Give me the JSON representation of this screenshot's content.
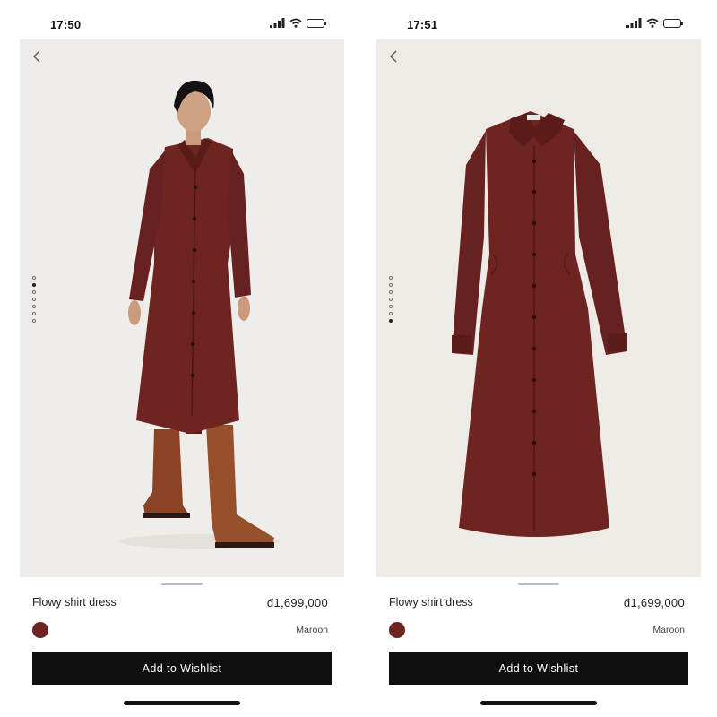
{
  "colors": {
    "dress": "#6e2420",
    "button_bg": "#0f0f0f",
    "photo_bg": "#efedea"
  },
  "screens": [
    {
      "status_time": "17:50",
      "image_type": "model-wearing-dress",
      "image_count": 7,
      "active_image": 1,
      "product_name": "Flowy shirt dress",
      "price": "đ1,699,000",
      "color_name": "Maroon",
      "button_label": "Add to Wishlist"
    },
    {
      "status_time": "17:51",
      "image_type": "dress-flat-lay",
      "image_count": 7,
      "active_image": 7,
      "product_name": "Flowy shirt dress",
      "price": "đ1,699,000",
      "color_name": "Maroon",
      "button_label": "Add to Wishlist"
    }
  ],
  "icons": [
    "back-chevron-icon",
    "signal-icon",
    "wifi-icon",
    "battery-icon"
  ]
}
